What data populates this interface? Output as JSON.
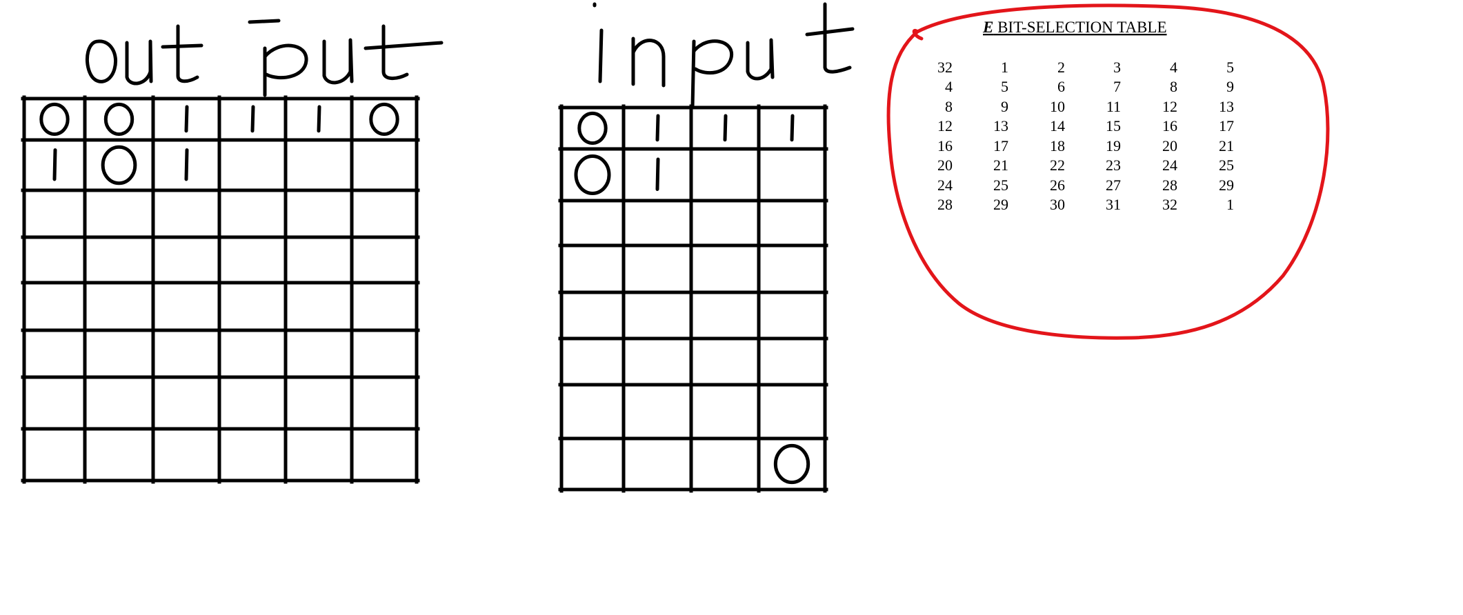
{
  "output_label": "output",
  "input_label": "input",
  "output_grid": {
    "rows": 8,
    "cols": 6,
    "marks": [
      [
        "0",
        "0",
        "1",
        "1",
        "1",
        "0"
      ],
      [
        "1",
        "0",
        "1",
        "",
        "",
        ""
      ],
      [
        "",
        "",
        "",
        "",
        "",
        ""
      ],
      [
        "",
        "",
        "",
        "",
        "",
        ""
      ],
      [
        "",
        "",
        "",
        "",
        "",
        ""
      ],
      [
        "",
        "",
        "",
        "",
        "",
        ""
      ],
      [
        "",
        "",
        "",
        "",
        "",
        ""
      ],
      [
        "",
        "",
        "",
        "",
        "",
        ""
      ]
    ]
  },
  "input_grid": {
    "rows": 8,
    "cols": 4,
    "marks": [
      [
        "0",
        "1",
        "1",
        "1"
      ],
      [
        "0",
        "1",
        "",
        ""
      ],
      [
        "",
        "",
        "",
        ""
      ],
      [
        "",
        "",
        "",
        ""
      ],
      [
        "",
        "",
        "",
        ""
      ],
      [
        "",
        "",
        "",
        ""
      ],
      [
        "",
        "",
        "",
        ""
      ],
      [
        "",
        "",
        "",
        "0"
      ]
    ]
  },
  "e_table": {
    "title_prefix": "E",
    "title_rest": " BIT-SELECTION TABLE",
    "rows": [
      [
        "32",
        "1",
        "2",
        "3",
        "4",
        "5"
      ],
      [
        "4",
        "5",
        "6",
        "7",
        "8",
        "9"
      ],
      [
        "8",
        "9",
        "10",
        "11",
        "12",
        "13"
      ],
      [
        "12",
        "13",
        "14",
        "15",
        "16",
        "17"
      ],
      [
        "16",
        "17",
        "18",
        "19",
        "20",
        "21"
      ],
      [
        "20",
        "21",
        "22",
        "23",
        "24",
        "25"
      ],
      [
        "24",
        "25",
        "26",
        "27",
        "28",
        "29"
      ],
      [
        "28",
        "29",
        "30",
        "31",
        "32",
        "1"
      ]
    ]
  },
  "colors": {
    "ink": "#000000",
    "highlight": "#e3151a"
  }
}
